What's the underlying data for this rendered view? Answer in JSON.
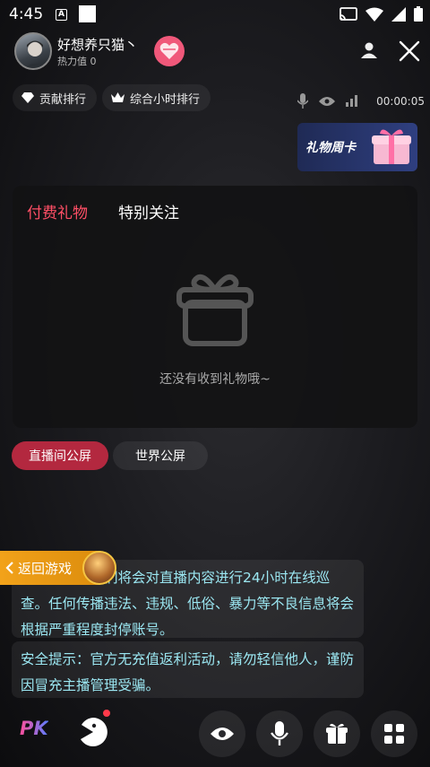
{
  "status_bar": {
    "time": "4:45",
    "a_icon_letter": "A"
  },
  "host": {
    "name": "好想养只猫丶",
    "heat": "热力值 0"
  },
  "ranks": {
    "contribution": "贡献排行",
    "hourly": "综合小时排行"
  },
  "live": {
    "timer": "00:00:05"
  },
  "gift_card": {
    "title": "礼物周卡"
  },
  "gift_panel": {
    "tabs": [
      "付费礼物",
      "特别关注"
    ],
    "empty_text": "还没有收到礼物哦~"
  },
  "chat_tabs": [
    "直播间公屏",
    "世界公屏"
  ],
  "messages": [
    "安全提示：我们将会对直播内容进行24小时在线巡查。任何传播违法、违规、低俗、暴力等不良信息将会根据严重程度封停账号。",
    "安全提示：官方无充值返利活动，请勿轻信他人，谨防因冒充主播管理受骗。"
  ],
  "back_game": {
    "label": "返回游戏"
  },
  "bottom_bar": {
    "pk_label": "PK"
  },
  "colors": {
    "accent": "#ff4f66",
    "chat_text": "#9be7f2",
    "active_tab": "#b3283f"
  }
}
